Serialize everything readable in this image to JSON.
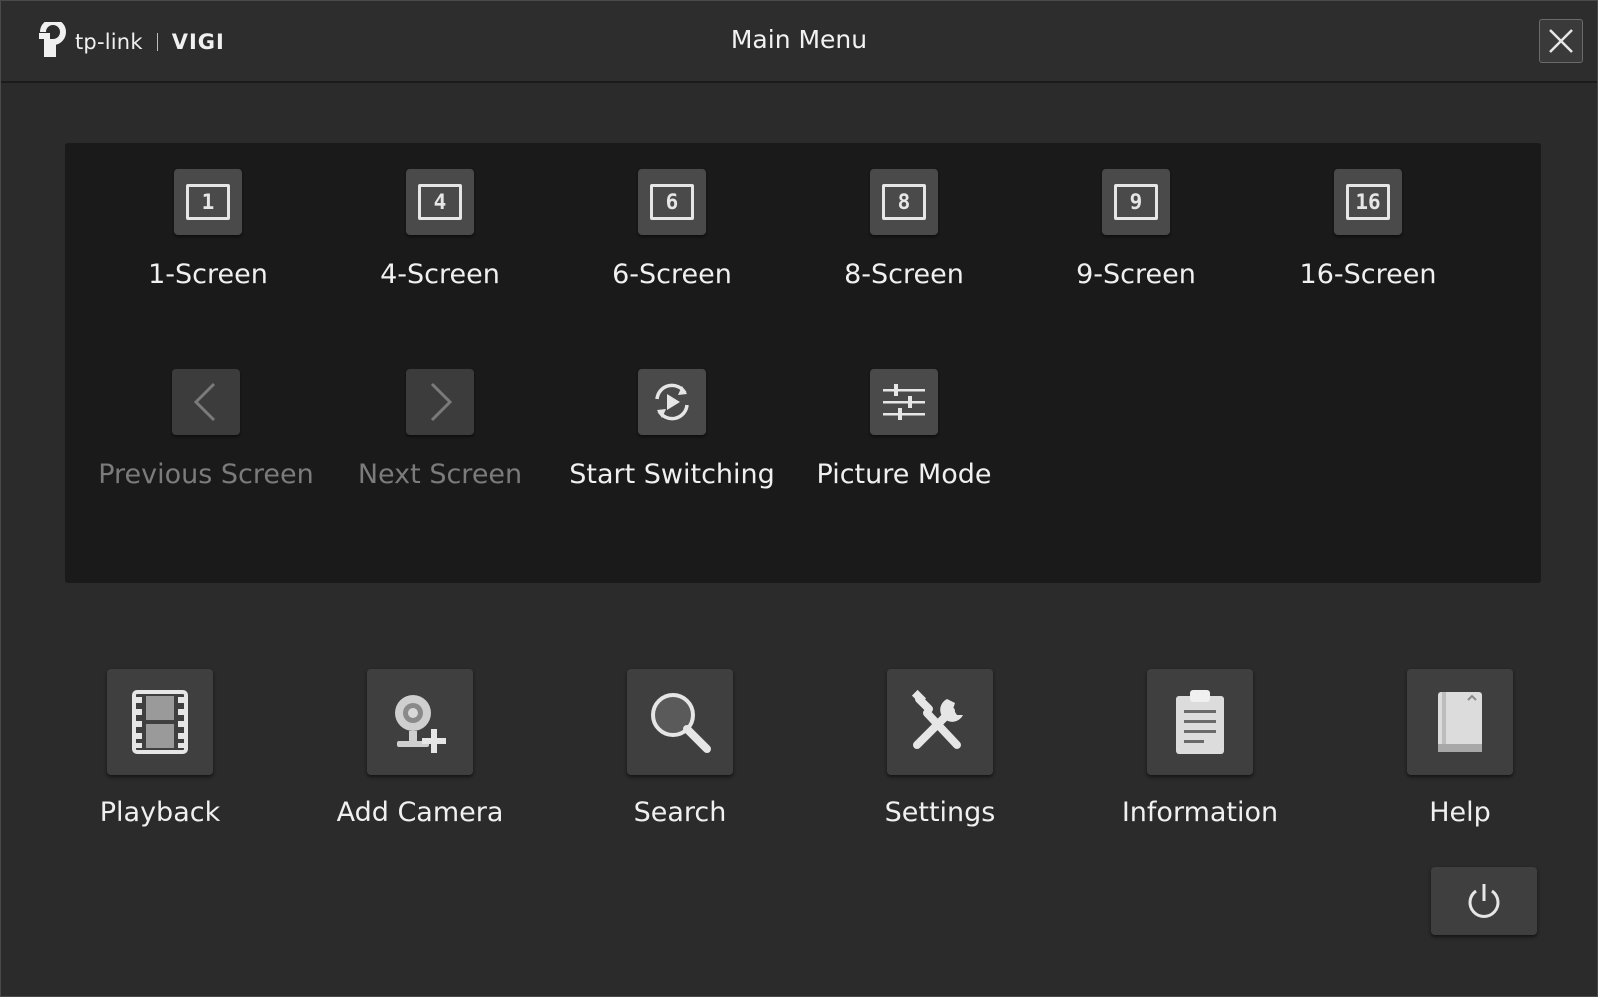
{
  "header": {
    "brand": "tp-link",
    "product": "VIGI",
    "title": "Main Menu"
  },
  "layouts": [
    {
      "id": "1-screen",
      "icon_text": "1",
      "label": "1-Screen"
    },
    {
      "id": "4-screen",
      "icon_text": "4",
      "label": "4-Screen"
    },
    {
      "id": "6-screen",
      "icon_text": "6",
      "label": "6-Screen"
    },
    {
      "id": "8-screen",
      "icon_text": "8",
      "label": "8-Screen"
    },
    {
      "id": "9-screen",
      "icon_text": "9",
      "label": "9-Screen"
    },
    {
      "id": "16-screen",
      "icon_text": "16",
      "label": "16-Screen"
    }
  ],
  "screen_controls": [
    {
      "id": "previous-screen",
      "label": "Previous Screen",
      "icon": "chevron-left-icon",
      "enabled": false
    },
    {
      "id": "next-screen",
      "label": "Next Screen",
      "icon": "chevron-right-icon",
      "enabled": false
    },
    {
      "id": "start-switching",
      "label": "Start Switching",
      "icon": "switching-icon",
      "enabled": true
    },
    {
      "id": "picture-mode",
      "label": "Picture Mode",
      "icon": "sliders-icon",
      "enabled": true
    }
  ],
  "main_actions": [
    {
      "id": "playback",
      "label": "Playback",
      "icon": "film-icon"
    },
    {
      "id": "add-camera",
      "label": "Add Camera",
      "icon": "camera-add-icon"
    },
    {
      "id": "search",
      "label": "Search",
      "icon": "magnifier-icon"
    },
    {
      "id": "settings",
      "label": "Settings",
      "icon": "tools-icon"
    },
    {
      "id": "information",
      "label": "Information",
      "icon": "clipboard-icon"
    },
    {
      "id": "help",
      "label": "Help",
      "icon": "book-icon"
    }
  ],
  "power": {
    "icon": "power-icon"
  },
  "colors": {
    "background": "#2b2b2b",
    "panel": "#1a1a1a",
    "button": "#4a4a4a",
    "disabled_text": "#7b7b7b"
  }
}
